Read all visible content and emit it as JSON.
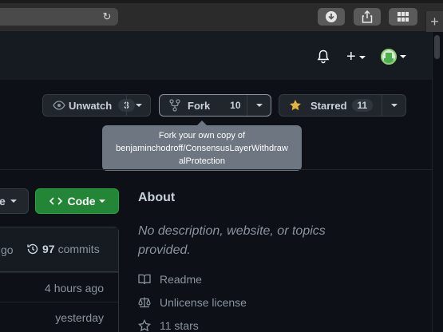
{
  "browser": {
    "reload_icon": "reload-icon",
    "download_icon": "download-icon",
    "share_icon": "share-icon",
    "tabs_icon": "tab-overview-icon",
    "new_tab": "+"
  },
  "header": {
    "bell_icon": "bell-icon",
    "plus": "+",
    "avatar_icon": "avatar"
  },
  "actions": {
    "watch": {
      "label": "Unwatch",
      "count": "3"
    },
    "fork": {
      "label": "Fork",
      "count": "10"
    },
    "star": {
      "label": "Starred",
      "count": "11"
    }
  },
  "tooltip": {
    "line1": "Fork your own copy of",
    "line2": "benjaminchodroff/ConsensusLayerWithdraw",
    "line3": "alProtection"
  },
  "code": {
    "branch_suffix": "e",
    "code_label": "Code",
    "ago_fragment": "go",
    "commits_count": "97",
    "commits_label": "commits",
    "rows": [
      "4 hours ago",
      "yesterday"
    ]
  },
  "about": {
    "title": "About",
    "description": "No description, website, or topics provided.",
    "readme": "Readme",
    "license": "Unlicense license",
    "stars": "11 stars"
  },
  "colors": {
    "background": "#0d1117",
    "header": "#161b22",
    "green": "#238636",
    "star": "#e3b341"
  }
}
